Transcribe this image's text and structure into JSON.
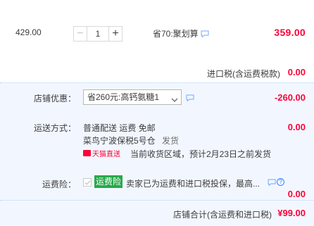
{
  "item": {
    "unit_price": "429.00",
    "quantity": "1",
    "minus_symbol": "−",
    "plus_symbol": "+",
    "discount_text": "省70:聚划算",
    "total": "359.00"
  },
  "tax": {
    "label": "进口税(含运费税款)",
    "amount": "0.00"
  },
  "coupon": {
    "label": "店铺优惠：",
    "selected": "省260元:高钙氨糖1",
    "amount": "-260.00"
  },
  "shipping": {
    "label": "运送方式：",
    "method": "普通配送 运费 免邮",
    "warehouse": "菜鸟宁波保税5号仓",
    "warehouse_suffix": "发货",
    "badge": "天猫直送",
    "delivery": "当前收货区域，预计2月23日之前发货",
    "amount": "0.00"
  },
  "insurance": {
    "label": "运费险：",
    "tag": "运费险",
    "text": "卖家已为运费和进口税投保，最高...",
    "help": "?",
    "amount": "0.00"
  },
  "store_total": {
    "label": "店铺合计(含运费和进口税)",
    "amount": "¥99.00"
  },
  "colors": {
    "price_red": "#ff0036",
    "panel_bg": "#f2f7ff",
    "insurance_green": "#28a94a"
  }
}
